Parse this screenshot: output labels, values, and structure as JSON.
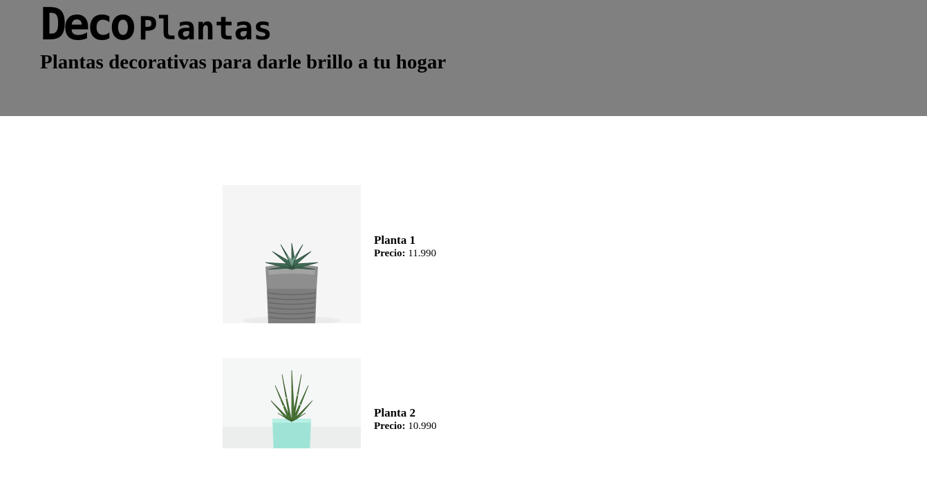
{
  "header": {
    "brand_part1": "Deco",
    "brand_part2": "Plantas",
    "tagline": "Plantas decorativas para darle brillo a tu hogar"
  },
  "products": [
    {
      "name": "Planta 1",
      "price_label": "Precio:",
      "price_value": "11.990",
      "image": "succulent-in-gray-pot"
    },
    {
      "name": "Planta 2",
      "price_label": "Precio:",
      "price_value": "10.990",
      "image": "aloe-in-mint-pot"
    }
  ],
  "colors": {
    "header_bg": "#808080",
    "page_bg": "#ffffff",
    "text": "#000000"
  }
}
